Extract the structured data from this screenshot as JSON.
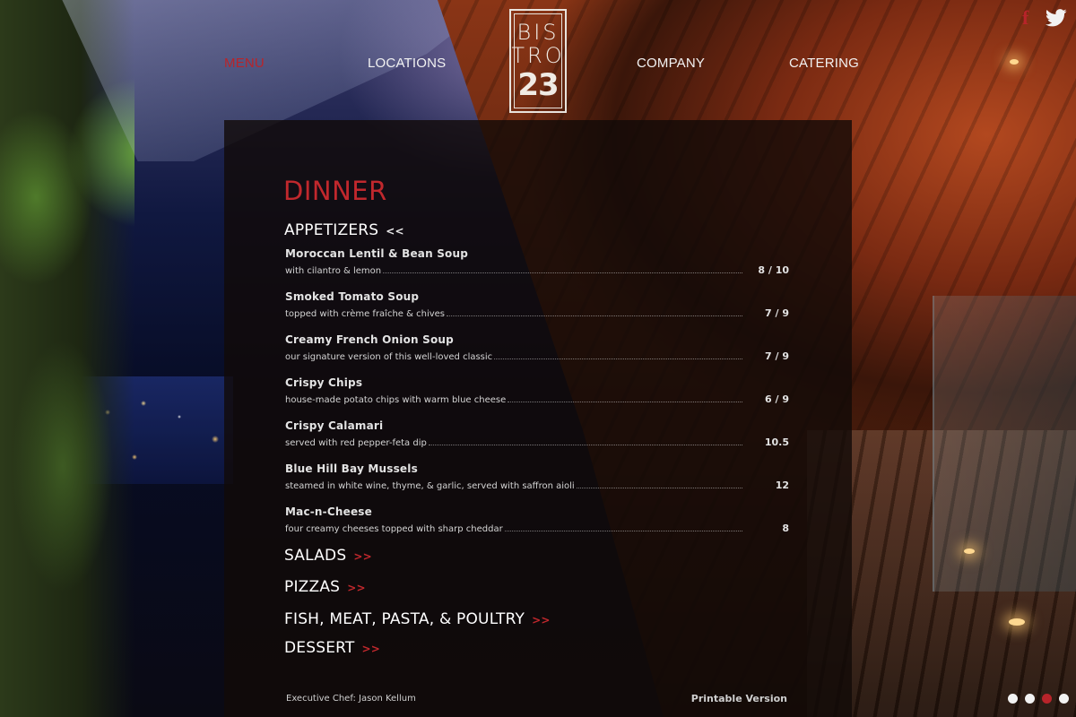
{
  "nav": {
    "items": [
      {
        "label": "MENU",
        "active": true
      },
      {
        "label": "LOCATIONS",
        "active": false
      },
      {
        "label": "COMPANY",
        "active": false
      },
      {
        "label": "CATERING",
        "active": false
      }
    ]
  },
  "logo": {
    "line1": "BIS",
    "line2": "TRO",
    "line3": "23"
  },
  "social": {
    "facebook_glyph": "f",
    "icons": [
      "facebook-icon",
      "twitter-icon"
    ]
  },
  "colors": {
    "accent": "#b8242a",
    "panel": "rgba(18,10,8,0.80)",
    "text": "#ffffff"
  },
  "menu": {
    "title": "DINNER",
    "sections": [
      {
        "label": "APPETIZERS",
        "arrow": "<<",
        "expanded": true
      },
      {
        "label": "SALADS",
        "arrow": ">>",
        "expanded": false
      },
      {
        "label": "PIZZAS",
        "arrow": ">>",
        "expanded": false
      },
      {
        "label": "FISH, MEAT, PASTA, & POULTRY",
        "arrow": ">>",
        "expanded": false
      },
      {
        "label": "DESSERT",
        "arrow": ">>",
        "expanded": false
      }
    ],
    "appetizers": [
      {
        "name": "Moroccan Lentil & Bean Soup",
        "desc": "with cilantro & lemon",
        "price": "8 / 10"
      },
      {
        "name": "Smoked Tomato Soup",
        "desc": "topped with crème fraîche & chives",
        "price": "7 / 9"
      },
      {
        "name": "Creamy French Onion Soup",
        "desc": "our signature version of this well-loved classic",
        "price": "7 / 9"
      },
      {
        "name": "Crispy Chips",
        "desc": "house-made potato chips with warm blue cheese",
        "price": "6 / 9"
      },
      {
        "name": "Crispy Calamari",
        "desc": "served with red pepper-feta dip",
        "price": "10.5"
      },
      {
        "name": "Blue Hill Bay Mussels",
        "desc": "steamed in white wine, thyme, & garlic, served with saffron aioli",
        "price": "12"
      },
      {
        "name": "Mac-n-Cheese",
        "desc": "four creamy cheeses topped with sharp cheddar",
        "price": "8"
      }
    ],
    "footer": {
      "chef": "Executive Chef: Jason Kellum",
      "printable": "Printable Version"
    }
  },
  "slider": {
    "count": 4,
    "active_index": 2
  }
}
